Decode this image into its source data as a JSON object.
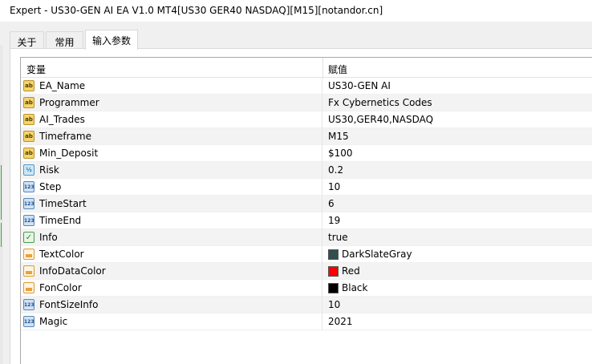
{
  "window": {
    "title": "Expert - US30-GEN AI EA V1.0 MT4[US30 GER40 NASDAQ][M15][notandor.cn]"
  },
  "tabs": [
    {
      "label": "关于",
      "active": false
    },
    {
      "label": "常用",
      "active": false
    },
    {
      "label": "输入参数",
      "active": true
    }
  ],
  "grid": {
    "header": {
      "variable": "变量",
      "value": "赋值"
    },
    "rows": [
      {
        "icon": "string-icon",
        "name": "EA_Name",
        "value": "US30-GEN AI"
      },
      {
        "icon": "string-icon",
        "name": "Programmer",
        "value": "Fx Cybernetics Codes"
      },
      {
        "icon": "string-icon",
        "name": "AI_Trades",
        "value": "US30,GER40,NASDAQ"
      },
      {
        "icon": "string-icon",
        "name": "Timeframe",
        "value": "M15"
      },
      {
        "icon": "string-icon",
        "name": "Min_Deposit",
        "value": "$100"
      },
      {
        "icon": "double-icon",
        "name": "Risk",
        "value": "0.2"
      },
      {
        "icon": "integer-icon",
        "name": "Step",
        "value": "10"
      },
      {
        "icon": "integer-icon",
        "name": "TimeStart",
        "value": "6"
      },
      {
        "icon": "integer-icon",
        "name": "TimeEnd",
        "value": "19"
      },
      {
        "icon": "bool-icon",
        "name": "Info",
        "value": "true"
      },
      {
        "icon": "color-icon",
        "name": "TextColor",
        "value": "DarkSlateGray",
        "color": "#2f4f4f"
      },
      {
        "icon": "color-icon",
        "name": "InfoDataColor",
        "value": "Red",
        "color": "#ff0000"
      },
      {
        "icon": "color-icon",
        "name": "FonColor",
        "value": "Black",
        "color": "#000000"
      },
      {
        "icon": "integer-icon",
        "name": "FontSizeInfo",
        "value": "10"
      },
      {
        "icon": "integer-icon",
        "name": "Magic",
        "value": "2021"
      }
    ]
  },
  "icon_glyphs": {
    "string": "ab",
    "double": "½",
    "integer": "123",
    "bool": "✓"
  }
}
